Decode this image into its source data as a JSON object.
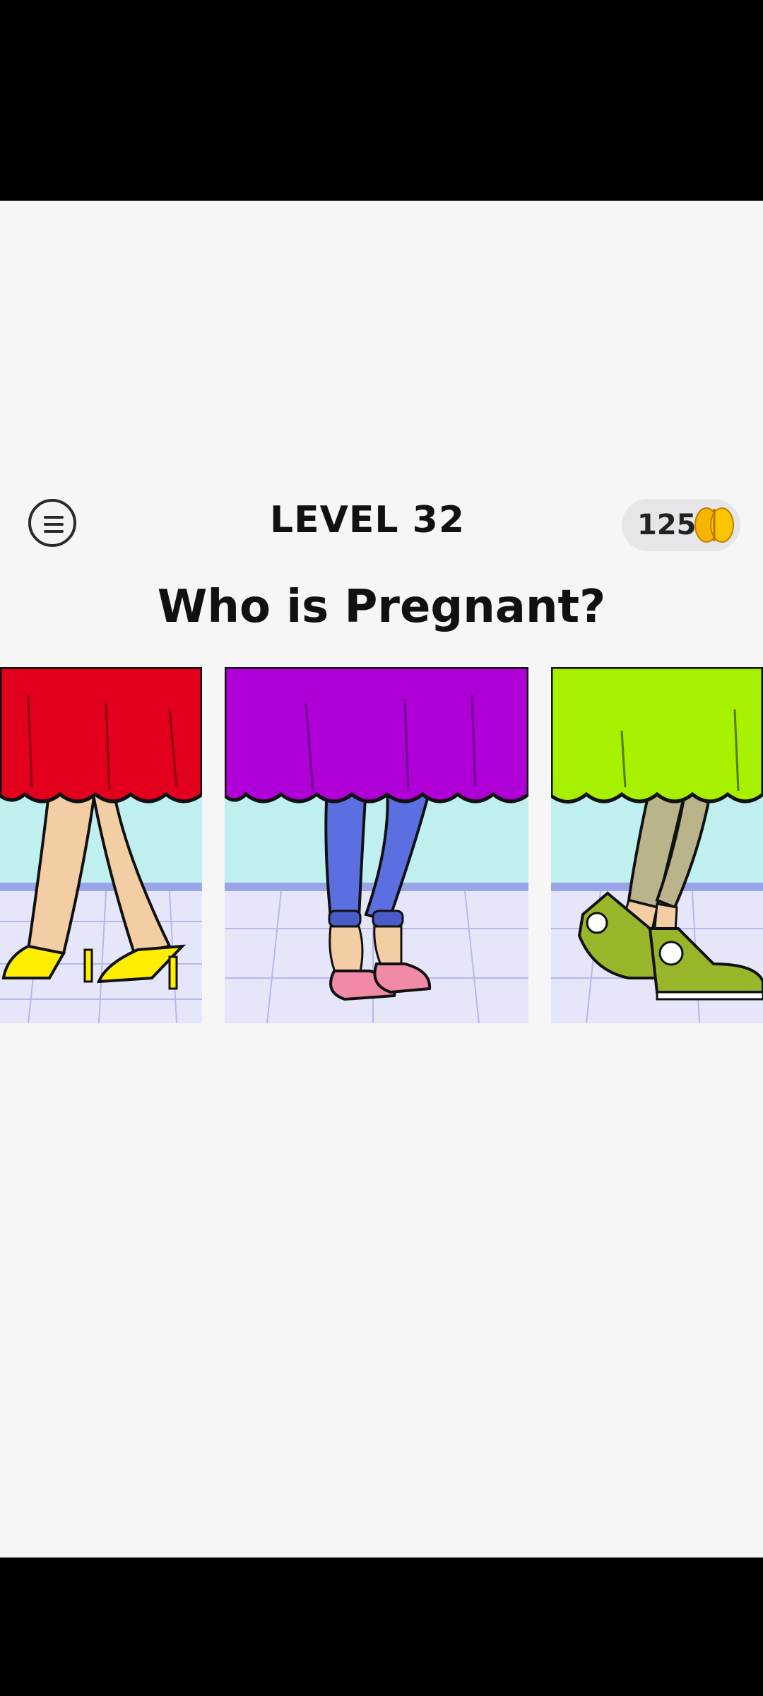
{
  "game": {
    "level_label": "LEVEL 32",
    "question": "Who is Pregnant?",
    "coins": "125",
    "coin_icon": "brain-icon",
    "menu_icon": "hamburger-menu-icon"
  },
  "choices": [
    {
      "id": 1,
      "skirt_color": "#e2001d",
      "shoes": "yellow high heels",
      "shoe_color": "#ffee00"
    },
    {
      "id": 2,
      "skirt_color": "#b000d8",
      "shoes": "pink flats with jeans",
      "shoe_color": "#f08aa6"
    },
    {
      "id": 3,
      "skirt_color": "#a6f000",
      "shoes": "green sneakers",
      "shoe_color": "#98b62a"
    }
  ]
}
